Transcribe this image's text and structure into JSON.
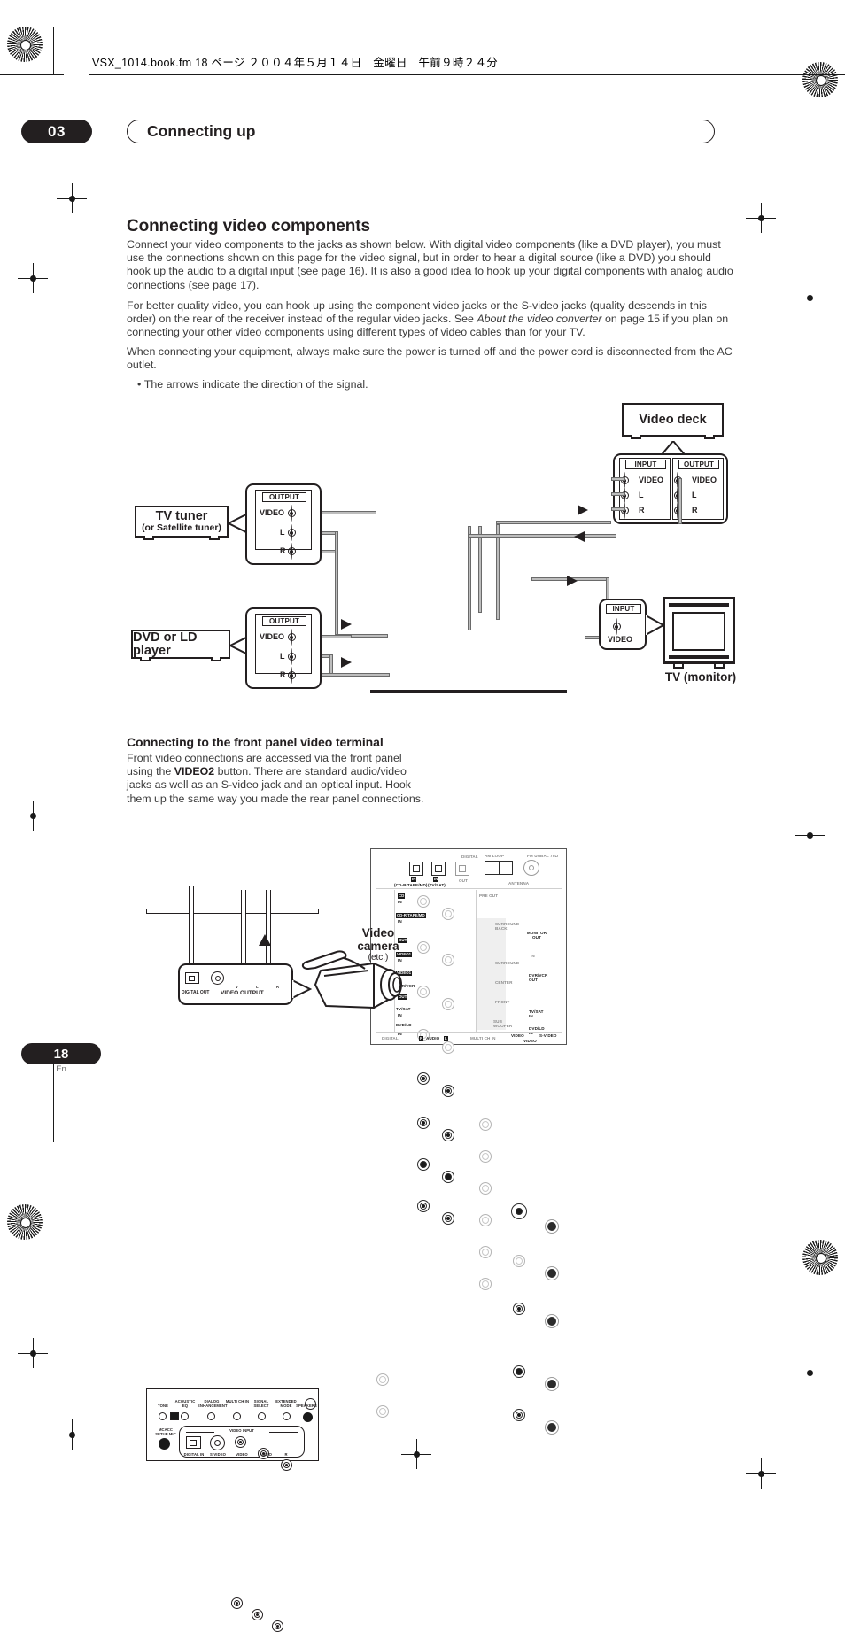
{
  "print_header": {
    "filename_line": "VSX_1014.book.fm 18 ページ ２００４年５月１４日　金曜日　午前９時２４分"
  },
  "chapter": {
    "number": "03",
    "title": "Connecting up"
  },
  "section": {
    "heading": "Connecting video components",
    "p1_a": "Connect your video components to the jacks as shown below. With digital video components (like a DVD player), you must use the connections shown on this page for the video signal, but in order to hear a digital source (like a DVD) you should hook up the audio to a digital input (see page 16). It is also a good idea to hook up your digital components with analog audio connections (see page 17).",
    "p2_a": "For better quality video, you can hook up using the component video jacks or the S-video jacks (quality descends in this order) on the rear of the receiver instead of the regular video jacks. See ",
    "p2_italic": "About the video converter",
    "p2_b": " on page 15 if you plan on connecting your other video components using different types of video cables than for your TV.",
    "p3": "When connecting your equipment, always make sure the power is turned off and the power cord is disconnected from the AC outlet.",
    "bullet1": "The arrows indicate the direction of the signal."
  },
  "subsection": {
    "heading": "Connecting to the front panel video terminal",
    "p1_a": "Front video connections are accessed via the front panel using the ",
    "p1_bold": "VIDEO2",
    "p1_b": " button. There are standard audio/video jacks as well as an S-video jack and an optical input. Hook them up the same way you made the rear panel connections."
  },
  "diagram": {
    "tv_tuner": {
      "name": "TV tuner",
      "subtitle": "(or Satellite tuner)",
      "panel_header": "OUTPUT",
      "jacks": [
        "VIDEO",
        "L",
        "R"
      ]
    },
    "dvd_player": {
      "name": "DVD or LD player",
      "panel_header": "OUTPUT",
      "jacks": [
        "VIDEO",
        "L",
        "R"
      ]
    },
    "video_deck": {
      "name": "Video deck",
      "input_header": "INPUT",
      "output_header": "OUTPUT",
      "input_jacks": [
        "VIDEO",
        "L",
        "R"
      ],
      "output_jacks": [
        "VIDEO",
        "L",
        "R"
      ]
    },
    "tv_monitor": {
      "name": "TV (monitor)",
      "panel_header": "INPUT",
      "jack": "VIDEO"
    },
    "receiver_rear": {
      "digital_label": "DIGITAL",
      "digital_terminals": [
        {
          "label": "IN",
          "sub": "(CD-R/TAPE/MD)"
        },
        {
          "label": "IN",
          "sub": "(TV/SAT)"
        },
        {
          "label": "OUT",
          "sub": ""
        }
      ],
      "antenna": {
        "am_loop": "AM LOOP",
        "fm_unbal": "FM UNBAL 75Ω",
        "section": "ANTENNA"
      },
      "monitor_out": "MONITOR OUT",
      "audio_rows": [
        {
          "tag": "CD",
          "sub": "IN"
        },
        {
          "tag": "CD-R/TAPE/MD",
          "sub": "IN"
        },
        {
          "tag": "CD-R/TAPE/MD",
          "sub": "OUT"
        },
        {
          "tag": "VIDEO1",
          "sub": "IN"
        },
        {
          "tag": "VIDEO1",
          "sub": "IN"
        },
        {
          "tag": "DVR/VCR",
          "sub": "OUT"
        },
        {
          "tag": "TV/SAT",
          "sub": "IN"
        },
        {
          "tag": "DVD/LD",
          "sub": "IN"
        }
      ],
      "pre_out_label": "PRE OUT",
      "preout_rows": [
        "SUB W.",
        "SURROUND BACK",
        "SURROUND",
        "CENTER",
        "FRONT",
        "SUB WOOFER"
      ],
      "video_rows": [
        "IN",
        "DVR/VCR OUT",
        "TV/SAT IN",
        "DVD/LD IN"
      ],
      "bottom_labels": {
        "digital": "DIGITAL",
        "audio": "AUDIO",
        "multi_ch_in": "MULTI CH IN",
        "video": "VIDEO",
        "s_video": "S-VIDEO",
        "video_group": "VIDEO"
      },
      "channel_marks": [
        "R",
        "L"
      ]
    },
    "front_panel": {
      "buttons": [
        "TONE",
        "ACOUSTIC EQ",
        "DIALOG ENHANCEMENT",
        "MULTI CH IN",
        "SIGNAL SELECT",
        "EXTENDED MODE",
        "SPEAKERS"
      ],
      "mic_label": "MCACC SETUP MIC",
      "video_input_label": "VIDEO INPUT",
      "jack_labels": [
        "DIGITAL IN",
        "S-VIDEO",
        "VIDEO",
        "AUDIO",
        "R"
      ]
    },
    "video_camera": {
      "name_line1": "Video",
      "name_line2": "camera",
      "name_line3": "(etc.)",
      "digital_out": "DIGITAL OUT",
      "video_output": "VIDEO OUTPUT",
      "output_jacks": [
        "V",
        "L",
        "R"
      ]
    }
  },
  "footer": {
    "page_number": "18",
    "language": "En"
  },
  "colors": {
    "ink": "#231f20",
    "body_text": "#3a3a3a",
    "cable": "#8c8c8c",
    "panel_gray": "#cfcfcf"
  }
}
